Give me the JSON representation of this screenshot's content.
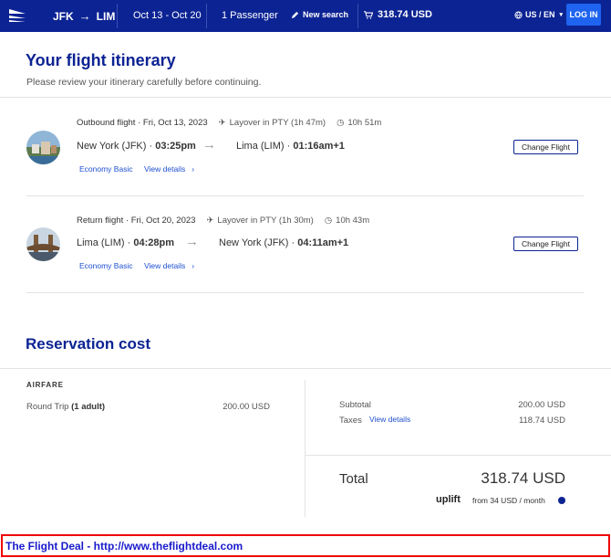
{
  "header": {
    "route_from": "JFK",
    "route_to": "LIM",
    "dates": "Oct 13 - Oct 20",
    "passengers": "1 Passenger",
    "new_search": "New search",
    "cart_total": "318.74 USD",
    "locale": "US / EN",
    "login": "LOG IN",
    "background_color": "#0c2393",
    "login_color": "#1e64f0"
  },
  "itinerary": {
    "title": "Your flight itinerary",
    "subtitle": "Please review your itinerary carefully before continuing.",
    "legs": [
      {
        "label": "Outbound flight",
        "date": "Fri, Oct 13, 2023",
        "layover": "Layover in PTY (1h 47m)",
        "duration": "10h 51m",
        "origin": "New York (JFK)",
        "depart_time": "03:25pm",
        "destination": "Lima (LIM)",
        "arrive_time": "01:16am+1",
        "cabin": "Economy Basic",
        "view_details": "View details",
        "change": "Change Flight"
      },
      {
        "label": "Return flight",
        "date": "Fri, Oct 20, 2023",
        "layover": "Layover in PTY (1h 30m)",
        "duration": "10h 43m",
        "origin": "Lima (LIM)",
        "depart_time": "04:28pm",
        "destination": "New York (JFK)",
        "arrive_time": "04:11am+1",
        "cabin": "Economy Basic",
        "view_details": "View details",
        "change": "Change Flight"
      }
    ]
  },
  "reservation": {
    "title": "Reservation cost",
    "airfare_label": "AIRFARE",
    "round_trip_label": "Round Trip",
    "round_trip_qty": "(1 adult)",
    "round_trip_value": "200.00 USD",
    "subtotal_label": "Subtotal",
    "subtotal_value": "200.00 USD",
    "taxes_label": "Taxes",
    "taxes_details": "View details",
    "taxes_value": "118.74 USD",
    "total_label": "Total",
    "total_value": "318.74 USD",
    "uplift_logo": "uplift",
    "uplift_from": "from 34 USD  / month"
  },
  "footer": {
    "text": "The Flight Deal - http://www.theflightdeal.com"
  }
}
